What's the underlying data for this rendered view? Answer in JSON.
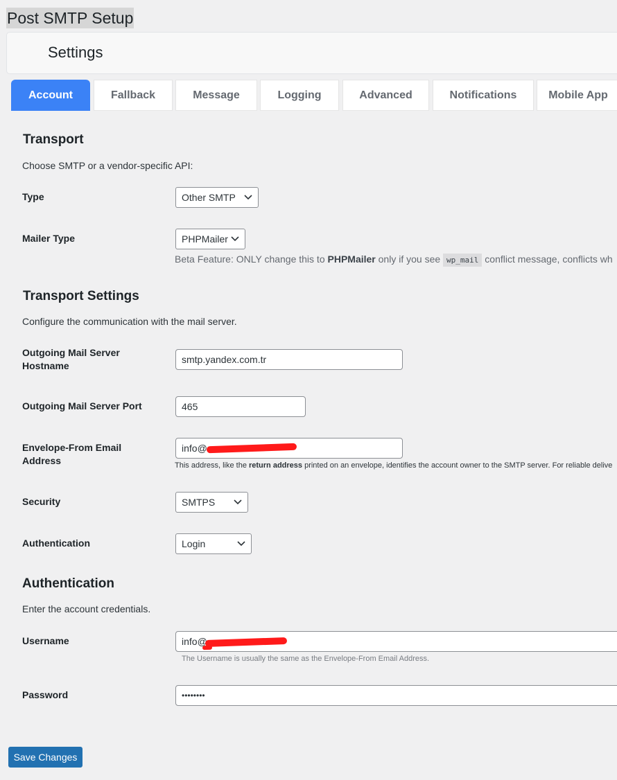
{
  "page_title": "Post SMTP Setup",
  "settings_label": "Settings",
  "tabs": [
    {
      "label": "Account",
      "active": true
    },
    {
      "label": "Fallback"
    },
    {
      "label": "Message"
    },
    {
      "label": "Logging"
    },
    {
      "label": "Advanced"
    },
    {
      "label": "Notifications"
    },
    {
      "label": "Mobile App"
    }
  ],
  "transport": {
    "heading": "Transport",
    "description": "Choose SMTP or a vendor-specific API:",
    "type_label": "Type",
    "type_value": "Other SMTP",
    "mailer_label": "Mailer Type",
    "mailer_value": "PHPMailer",
    "mailer_note_1": "Beta Feature: ONLY change this to ",
    "mailer_note_bold": "PHPMailer",
    "mailer_note_2": " only if you see ",
    "mailer_note_code": "wp_mail",
    "mailer_note_3": " conflict message, conflicts wh"
  },
  "transport_settings": {
    "heading": "Transport Settings",
    "description": "Configure the communication with the mail server.",
    "hostname_label_1": "Outgoing Mail Server",
    "hostname_label_2": "Hostname",
    "hostname_value": "smtp.yandex.com.tr",
    "port_label": "Outgoing Mail Server Port",
    "port_value": "465",
    "envelope_label_1": "Envelope-From Email",
    "envelope_label_2": "Address",
    "envelope_value": "info@",
    "envelope_note_1": "This address, like the ",
    "envelope_note_bold": "return address",
    "envelope_note_2": " printed on an envelope, identifies the account owner to the SMTP server. For reliable delive",
    "security_label": "Security",
    "security_value": "SMTPS",
    "auth_label": "Authentication",
    "auth_value": "Login"
  },
  "authentication": {
    "heading": "Authentication",
    "description": "Enter the account credentials.",
    "username_label": "Username",
    "username_value": "info@",
    "username_note": "The Username is usually the same as the Envelope-From Email Address.",
    "password_label": "Password",
    "password_value": "••••••••"
  },
  "save_button": "Save Changes",
  "colors": {
    "accent": "#3b82f6",
    "button": "#2271b1",
    "redaction": "#ff1a1a"
  }
}
